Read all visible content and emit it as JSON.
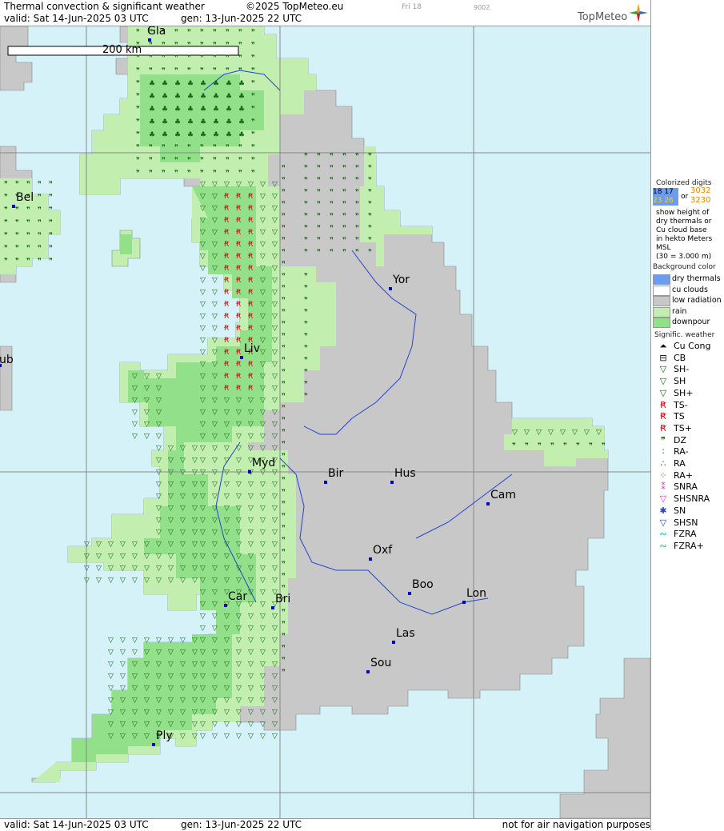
{
  "header": {
    "title": "Thermal convection & significant weather",
    "copyright": "©2025 TopMeteo.eu",
    "valid": "valid:  Sat  14-Jun-2025  03 UTC",
    "gen": "gen: 13-Jun-2025 22 UTC",
    "day": "Fri 18",
    "code": "9002",
    "brand": "TopMeteo"
  },
  "footer": {
    "valid": "valid:  Sat  14-Jun-2025  03 UTC",
    "gen": "gen: 13-Jun-2025 22 UTC",
    "note": "not for air navigation purposes"
  },
  "map": {
    "scale_label": "200 km",
    "cities": [
      {
        "name": "Gla"
      },
      {
        "name": "Bel"
      },
      {
        "name": "ub"
      },
      {
        "name": "Yor"
      },
      {
        "name": "Liv"
      },
      {
        "name": "Myd"
      },
      {
        "name": "Bir"
      },
      {
        "name": "Hus"
      },
      {
        "name": "Cam"
      },
      {
        "name": "Oxf"
      },
      {
        "name": "Boo"
      },
      {
        "name": "Lon"
      },
      {
        "name": "Car"
      },
      {
        "name": "Bri"
      },
      {
        "name": "Las"
      },
      {
        "name": "Sou"
      },
      {
        "name": "Ply"
      }
    ],
    "colors": {
      "sea": "#d4f2f8",
      "low_radiation": "#c8c8c8",
      "rain": "#c2efb0",
      "downpour": "#93e08a",
      "dry_thermals": "#6b9cf0",
      "grid": "#888888",
      "river": "#2244cc",
      "symbol_green": "#116611",
      "symbol_red": "#cc1111"
    }
  },
  "legend": {
    "digits_title": "Colorized digits",
    "digits_a": [
      "18 17",
      "23 26"
    ],
    "digits_or": "or",
    "digits_b": [
      "3032",
      "3230"
    ],
    "digits_desc": [
      "show height of",
      "dry thermals or",
      "Cu cloud base",
      "in hekto Meters",
      "MSL",
      "(30 = 3.000 m)"
    ],
    "bg_title": "Background color",
    "bg_items": [
      {
        "label": "dry thermals",
        "color": "#6b9cf0"
      },
      {
        "label": "cu clouds",
        "color": "#ffffff"
      },
      {
        "label": "low radiation",
        "color": "#c8c8c8"
      },
      {
        "label": "rain",
        "color": "#c2efb0"
      },
      {
        "label": "downpour",
        "color": "#93e08a"
      }
    ],
    "sig_title": "Signific. weather",
    "sig_items": [
      {
        "label": "Cu Cong",
        "glyph": "⏶",
        "color": "#000000"
      },
      {
        "label": "CB",
        "glyph": "⊟",
        "color": "#000000"
      },
      {
        "label": "SH-",
        "glyph": "▽",
        "color": "#116611"
      },
      {
        "label": "SH",
        "glyph": "▽",
        "color": "#116611"
      },
      {
        "label": "SH+",
        "glyph": "▽",
        "color": "#116611"
      },
      {
        "label": "TS-",
        "glyph": "Ꞧ",
        "color": "#cc1111"
      },
      {
        "label": "TS",
        "glyph": "Ꞧ",
        "color": "#cc1111"
      },
      {
        "label": "TS+",
        "glyph": "Ꞧ",
        "color": "#cc1111"
      },
      {
        "label": "DZ",
        "glyph": "❞",
        "color": "#116611"
      },
      {
        "label": "RA-",
        "glyph": "∶",
        "color": "#116611"
      },
      {
        "label": "RA",
        "glyph": "∴",
        "color": "#116611"
      },
      {
        "label": "RA+",
        "glyph": "⁘",
        "color": "#116611"
      },
      {
        "label": "SNRA",
        "glyph": "⁑",
        "color": "#cc33cc"
      },
      {
        "label": "SHSNRA",
        "glyph": "▽",
        "color": "#cc33cc"
      },
      {
        "label": "SN",
        "glyph": "✱",
        "color": "#2244cc"
      },
      {
        "label": "SHSN",
        "glyph": "▽",
        "color": "#2244cc"
      },
      {
        "label": "FZRA",
        "glyph": "∾",
        "color": "#11bbcc"
      },
      {
        "label": "FZRA+",
        "glyph": "∾",
        "color": "#11bbcc"
      }
    ]
  }
}
